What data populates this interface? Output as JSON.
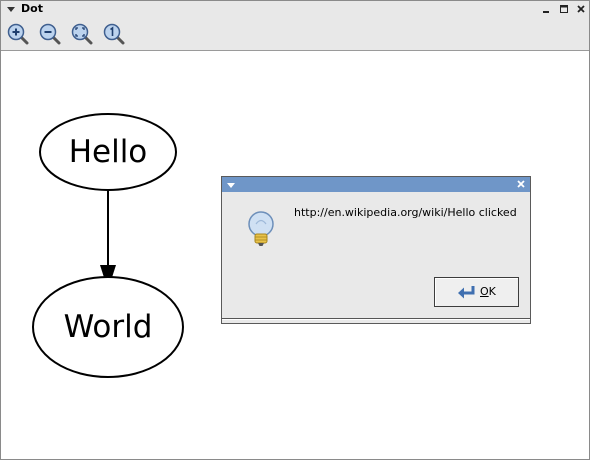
{
  "window": {
    "title": "Dot"
  },
  "toolbar": {
    "buttons": [
      {
        "name": "zoom-in",
        "icon": "zoom-in-icon"
      },
      {
        "name": "zoom-out",
        "icon": "zoom-out-icon"
      },
      {
        "name": "zoom-to-fit",
        "icon": "zoom-fit-icon"
      },
      {
        "name": "zoom-100",
        "icon": "zoom-100-icon"
      }
    ]
  },
  "graph": {
    "nodes": [
      {
        "id": "hello",
        "label": "Hello"
      },
      {
        "id": "world",
        "label": "World"
      }
    ],
    "edges": [
      {
        "from": "hello",
        "to": "world"
      }
    ]
  },
  "dialog": {
    "message": "http://en.wikipedia.org/wiki/Hello clicked",
    "ok_label_accel": "O",
    "ok_label_rest": "K",
    "icon": "lightbulb-info-icon"
  },
  "colors": {
    "window_chrome": "#e8e8e8",
    "dialog_titlebar": "#6f96c8",
    "dialog_body": "#e9e9e9"
  }
}
